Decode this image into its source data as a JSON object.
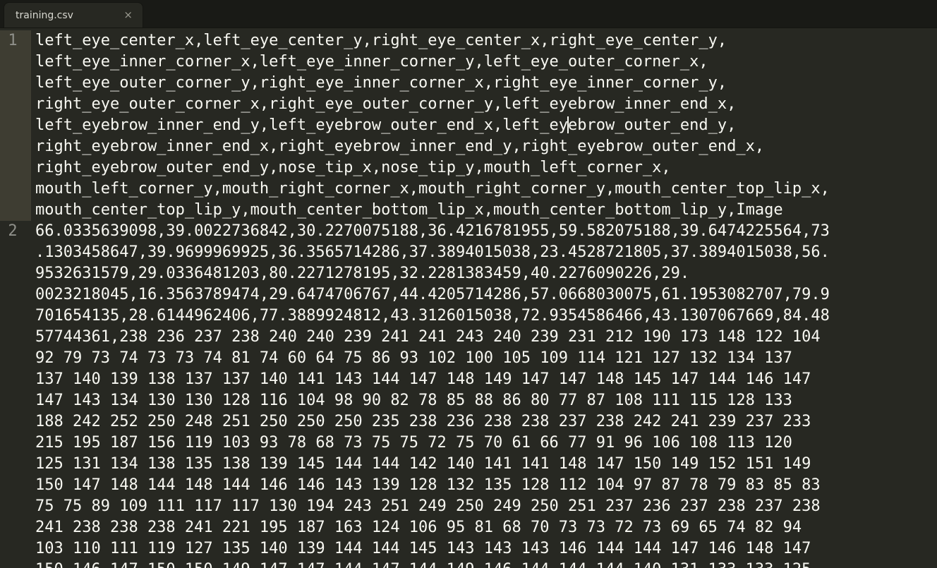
{
  "tab": {
    "filename": "training.csv",
    "close_glyph": "×"
  },
  "gutter": {
    "line_1": "1",
    "line_2": "2"
  },
  "line1": {
    "rows": [
      "left_eye_center_x,left_eye_center_y,right_eye_center_x,right_eye_center_y,",
      "left_eye_inner_corner_x,left_eye_inner_corner_y,left_eye_outer_corner_x,",
      "left_eye_outer_corner_y,right_eye_inner_corner_x,right_eye_inner_corner_y,",
      "right_eye_outer_corner_x,right_eye_outer_corner_y,left_eyebrow_inner_end_x,",
      {
        "before": "left_eyebrow_inner_end_y,left_eyebrow_outer_end_x,left_ey",
        "after": "ebrow_outer_end_y,"
      },
      "right_eyebrow_inner_end_x,right_eyebrow_inner_end_y,right_eyebrow_outer_end_x,",
      "right_eyebrow_outer_end_y,nose_tip_x,nose_tip_y,mouth_left_corner_x,",
      "mouth_left_corner_y,mouth_right_corner_x,mouth_right_corner_y,mouth_center_top_lip_x,",
      "mouth_center_top_lip_y,mouth_center_bottom_lip_x,mouth_center_bottom_lip_y,Image"
    ]
  },
  "line2": {
    "rows": [
      "66.0335639098,39.0022736842,30.2270075188,36.4216781955,59.582075188,39.6474225564,73",
      ".1303458647,39.9699969925,36.3565714286,37.3894015038,23.4528721805,37.3894015038,56.",
      "9532631579,29.0336481203,80.2271278195,32.2281383459,40.2276090226,29.",
      "0023218045,16.3563789474,29.6474706767,44.4205714286,57.0668030075,61.1953082707,79.9",
      "701654135,28.6144962406,77.3889924812,43.3126015038,72.9354586466,43.1307067669,84.48",
      "57744361,238 236 237 238 240 240 239 241 241 243 240 239 231 212 190 173 148 122 104",
      "92 79 73 74 73 73 74 81 74 60 64 75 86 93 102 100 105 109 114 121 127 132 134 137",
      "137 140 139 138 137 137 140 141 143 144 147 148 149 147 147 148 145 147 144 146 147",
      "147 143 134 130 130 128 116 104 98 90 82 78 85 88 86 80 77 87 108 111 115 128 133",
      "188 242 252 250 248 251 250 250 250 235 238 236 238 238 237 238 242 241 239 237 233",
      "215 195 187 156 119 103 93 78 68 73 75 75 72 75 70 61 66 77 91 96 106 108 113 120",
      "125 131 134 138 135 138 139 145 144 144 142 140 141 141 148 147 150 149 152 151 149",
      "150 147 148 144 148 144 146 146 143 139 128 132 135 128 112 104 97 87 78 79 83 85 83",
      "75 75 89 109 111 117 117 130 194 243 251 249 250 249 250 251 237 236 237 238 237 238",
      "241 238 238 238 241 221 195 187 163 124 106 95 81 68 70 73 73 72 73 69 65 74 82 94",
      "103 110 111 119 127 135 140 139 144 144 145 143 143 143 146 144 144 147 146 148 147",
      "150 146 147 150 150 149 147 147 144 147 144 149 146 144 144 144 140 131 133 133 125"
    ]
  }
}
